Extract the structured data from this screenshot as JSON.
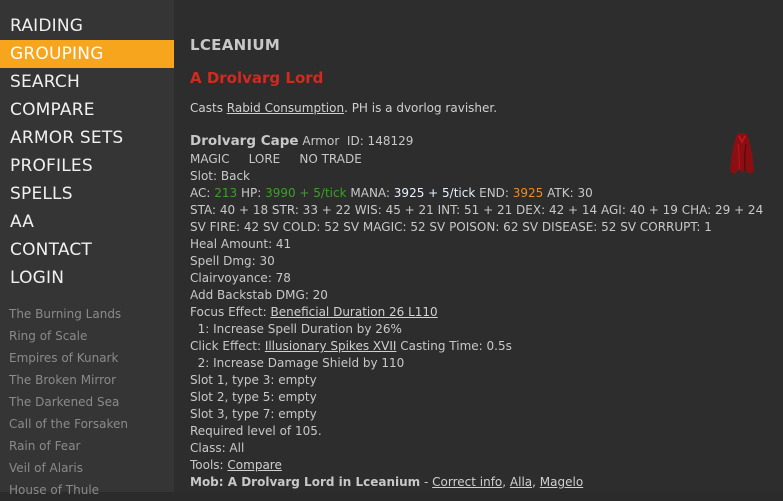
{
  "nav": {
    "items": [
      "RAIDING",
      "GROUPING",
      "SEARCH",
      "COMPARE",
      "ARMOR SETS",
      "PROFILES",
      "SPELLS",
      "AA",
      "CONTACT",
      "LOGIN"
    ],
    "active": "GROUPING"
  },
  "expansions": [
    "The Burning Lands",
    "Ring of Scale",
    "Empires of Kunark",
    "The Broken Mirror",
    "The Darkened Sea",
    "Call of the Forsaken",
    "Rain of Fear",
    "Veil of Alaris",
    "House of Thule"
  ],
  "zone": "LCEANIUM",
  "mob": {
    "name": "A Drolvarg Lord",
    "desc_prefix": "Casts ",
    "desc_link": "Rabid Consumption",
    "desc_suffix": ". PH is a dvorlog ravisher."
  },
  "item": {
    "name": "Drolvarg Cape",
    "type": "Armor",
    "id_text": "ID: 148129",
    "flags": "MAGIC     LORE     NO TRADE",
    "slot": "Slot: Back",
    "ac_label": "AC: ",
    "ac": "213",
    "hp_label": " HP: ",
    "hp": "3990 + 5/tick",
    "mana_label": " MANA: ",
    "mana": "3925",
    "mana_regen": " + 5/tick",
    "end_label": " END: ",
    "end": "3925",
    "atk": " ATK: 30",
    "stats": "STA: 40 + 18 STR: 33 + 22 WIS: 45 + 21 INT: 51 + 21 DEX: 42 + 14 AGI: 40 + 19 CHA: 29 + 24",
    "resists": "SV FIRE: 42 SV COLD: 52 SV MAGIC: 52 SV POISON: 62 SV DISEASE: 52 SV CORRUPT: 1",
    "heal": "Heal Amount: 41",
    "spell_dmg": "Spell Dmg: 30",
    "clairvoyance": "Clairvoyance: 78",
    "backstab": "Add Backstab DMG: 20",
    "focus_label": "Focus Effect: ",
    "focus_link": "Beneficial Duration 26 L110",
    "focus_detail": "  1: Increase Spell Duration by 26%",
    "click_label": "Click Effect: ",
    "click_link": "Illusionary Spikes XVII",
    "click_cast": " Casting Time: 0.5s",
    "click_detail": "  2: Increase Damage Shield by 110",
    "slot1": "Slot 1, type 3: empty",
    "slot2": "Slot 2, type 5: empty",
    "slot3": "Slot 3, type 7: empty",
    "req_level": "Required level of 105.",
    "class": "Class: All",
    "tools_label": "Tools: ",
    "tools_link": "Compare",
    "mobline_label": "Mob: A Drolvarg Lord in Lceanium",
    "mobline_sep": " - ",
    "link_correct": "Correct info",
    "comma1": ", ",
    "link_alla": "Alla",
    "comma2": ", ",
    "link_magelo": "Magelo"
  },
  "colors": {
    "accent": "#f7a51c",
    "mob_title": "#d12a1e",
    "hp": "#3f9e2a",
    "end": "#f08a1e",
    "cape": "#8b0f12"
  },
  "icons": {
    "item_icon": "cape-icon"
  }
}
